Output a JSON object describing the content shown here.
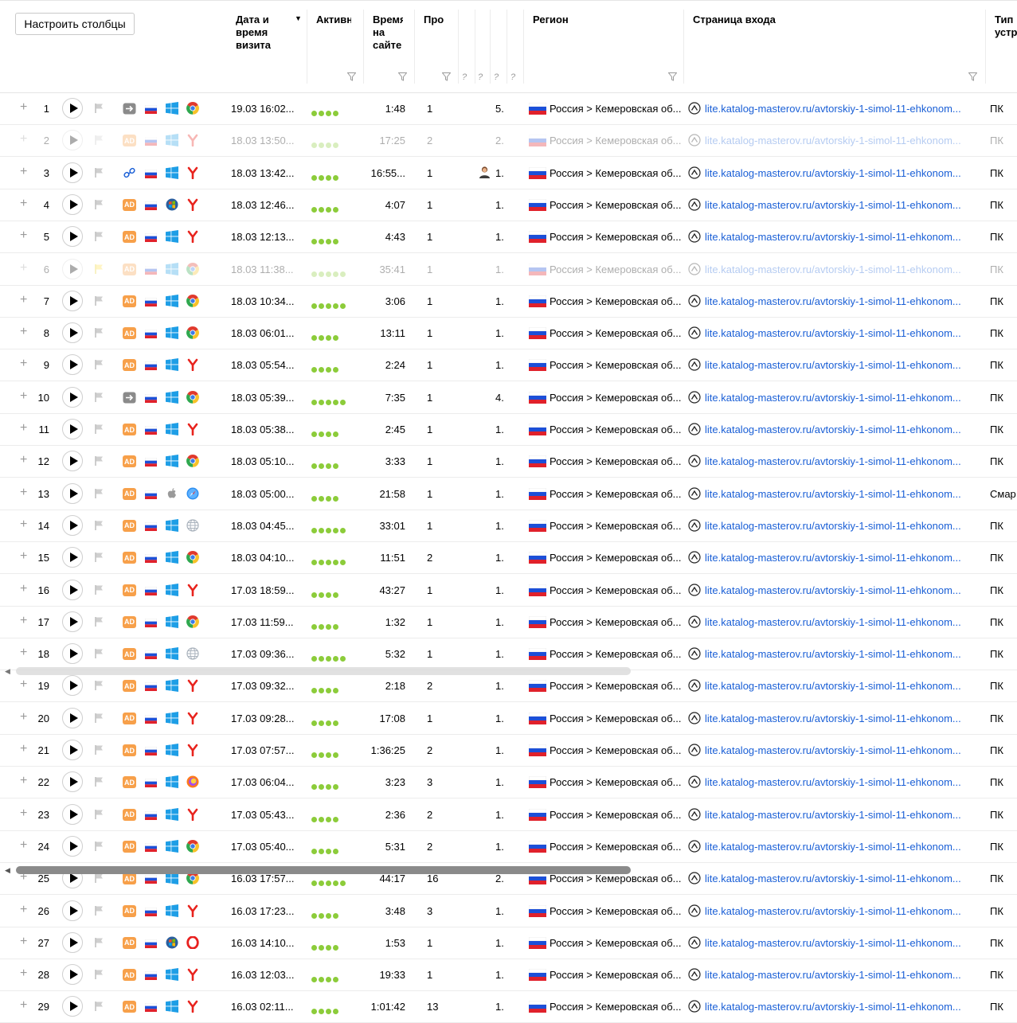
{
  "toolbar": {
    "configure_columns": "Настроить столбцы"
  },
  "columns": {
    "date": "Дата и\nвремя\nвизита",
    "activity": "Активн",
    "time": "Время\nна\nсайте",
    "pages": "Про",
    "region": "Регион",
    "entry_page": "Страница входа",
    "device": "Тип\nустр"
  },
  "sort_indicator": "▼",
  "filter_qmarks": [
    "?",
    "?",
    "?",
    "?"
  ],
  "rows": [
    {
      "n": "1",
      "src": "arrow",
      "os": "windows",
      "br": "chrome",
      "dt": "19.03 16:02...",
      "act": 4,
      "tm": "1:48",
      "pv": "1",
      "dep": "5.",
      "reg": "Россия > Кемеровская об...",
      "url": "lite.katalog-masterov.ru/avtorskiy-1-simol-11-ehkonom...",
      "dev": "ПК"
    },
    {
      "n": "2",
      "dim": true,
      "src": "ad",
      "os": "windows",
      "br": "yandex",
      "dt": "18.03 13:50...",
      "act": 4,
      "tm": "17:25",
      "pv": "2",
      "dep": "2.",
      "reg": "Россия > Кемеровская об...",
      "url": "lite.katalog-masterov.ru/avtorskiy-1-simol-11-ehkonom...",
      "dev": "ПК"
    },
    {
      "n": "3",
      "src": "link",
      "os": "windows",
      "br": "yandex",
      "dt": "18.03 13:42...",
      "act": 4,
      "tm": "16:55...",
      "pv": "1",
      "dep": "1.",
      "avatar": true,
      "reg": "Россия > Кемеровская об...",
      "url": "lite.katalog-masterov.ru/avtorskiy-1-simol-11-ehkonom...",
      "dev": "ПК"
    },
    {
      "n": "4",
      "src": "ad",
      "os": "win7",
      "br": "yandex",
      "dt": "18.03 12:46...",
      "act": 4,
      "tm": "4:07",
      "pv": "1",
      "dep": "1.",
      "reg": "Россия > Кемеровская об...",
      "url": "lite.katalog-masterov.ru/avtorskiy-1-simol-11-ehkonom...",
      "dev": "ПК"
    },
    {
      "n": "5",
      "src": "ad",
      "os": "windows",
      "br": "yandex",
      "dt": "18.03 12:13...",
      "act": 4,
      "tm": "4:43",
      "pv": "1",
      "dep": "1.",
      "reg": "Россия > Кемеровская об...",
      "url": "lite.katalog-masterov.ru/avtorskiy-1-simol-11-ehkonom...",
      "dev": "ПК"
    },
    {
      "n": "6",
      "dim": true,
      "flag_yellow": true,
      "src": "ad",
      "os": "windows",
      "br": "chrome",
      "dt": "18.03 11:38...",
      "act": 5,
      "tm": "35:41",
      "pv": "1",
      "dep": "1.",
      "reg": "Россия > Кемеровская об...",
      "url": "lite.katalog-masterov.ru/avtorskiy-1-simol-11-ehkonom...",
      "dev": "ПК"
    },
    {
      "n": "7",
      "src": "ad",
      "os": "windows",
      "br": "chrome",
      "dt": "18.03 10:34...",
      "act": 5,
      "tm": "3:06",
      "pv": "1",
      "dep": "1.",
      "reg": "Россия > Кемеровская об...",
      "url": "lite.katalog-masterov.ru/avtorskiy-1-simol-11-ehkonom...",
      "dev": "ПК"
    },
    {
      "n": "8",
      "src": "ad",
      "os": "windows",
      "br": "chrome",
      "dt": "18.03 06:01...",
      "act": 4,
      "tm": "13:11",
      "pv": "1",
      "dep": "1.",
      "reg": "Россия > Кемеровская об...",
      "url": "lite.katalog-masterov.ru/avtorskiy-1-simol-11-ehkonom...",
      "dev": "ПК"
    },
    {
      "n": "9",
      "src": "ad",
      "os": "windows",
      "br": "yandex",
      "dt": "18.03 05:54...",
      "act": 4,
      "tm": "2:24",
      "pv": "1",
      "dep": "1.",
      "reg": "Россия > Кемеровская об...",
      "url": "lite.katalog-masterov.ru/avtorskiy-1-simol-11-ehkonom...",
      "dev": "ПК"
    },
    {
      "n": "10",
      "src": "arrow",
      "os": "windows",
      "br": "chrome",
      "dt": "18.03 05:39...",
      "act": 5,
      "tm": "7:35",
      "pv": "1",
      "dep": "4.",
      "reg": "Россия > Кемеровская об...",
      "url": "lite.katalog-masterov.ru/avtorskiy-1-simol-11-ehkonom...",
      "dev": "ПК"
    },
    {
      "n": "11",
      "src": "ad",
      "os": "windows",
      "br": "yandex",
      "dt": "18.03 05:38...",
      "act": 4,
      "tm": "2:45",
      "pv": "1",
      "dep": "1.",
      "reg": "Россия > Кемеровская об...",
      "url": "lite.katalog-masterov.ru/avtorskiy-1-simol-11-ehkonom...",
      "dev": "ПК"
    },
    {
      "n": "12",
      "src": "ad",
      "os": "windows",
      "br": "chrome",
      "dt": "18.03 05:10...",
      "act": 4,
      "tm": "3:33",
      "pv": "1",
      "dep": "1.",
      "reg": "Россия > Кемеровская об...",
      "url": "lite.katalog-masterov.ru/avtorskiy-1-simol-11-ehkonom...",
      "dev": "ПК"
    },
    {
      "n": "13",
      "src": "ad",
      "os": "apple",
      "br": "safari",
      "dt": "18.03 05:00...",
      "act": 4,
      "tm": "21:58",
      "pv": "1",
      "dep": "1.",
      "reg": "Россия > Кемеровская об...",
      "url": "lite.katalog-masterov.ru/avtorskiy-1-simol-11-ehkonom...",
      "dev": "Смар"
    },
    {
      "n": "14",
      "src": "ad",
      "os": "windows",
      "br": "globe",
      "dt": "18.03 04:45...",
      "act": 5,
      "tm": "33:01",
      "pv": "1",
      "dep": "1.",
      "reg": "Россия > Кемеровская об...",
      "url": "lite.katalog-masterov.ru/avtorskiy-1-simol-11-ehkonom...",
      "dev": "ПК"
    },
    {
      "n": "15",
      "src": "ad",
      "os": "windows",
      "br": "chrome",
      "dt": "18.03 04:10...",
      "act": 5,
      "tm": "11:51",
      "pv": "2",
      "dep": "1.",
      "reg": "Россия > Кемеровская об...",
      "url": "lite.katalog-masterov.ru/avtorskiy-1-simol-11-ehkonom...",
      "dev": "ПК"
    },
    {
      "n": "16",
      "src": "ad",
      "os": "windows",
      "br": "yandex",
      "dt": "17.03 18:59...",
      "act": 4,
      "tm": "43:27",
      "pv": "1",
      "dep": "1.",
      "reg": "Россия > Кемеровская об...",
      "url": "lite.katalog-masterov.ru/avtorskiy-1-simol-11-ehkonom...",
      "dev": "ПК"
    },
    {
      "n": "17",
      "src": "ad",
      "os": "windows",
      "br": "chrome",
      "dt": "17.03 11:59...",
      "act": 4,
      "tm": "1:32",
      "pv": "1",
      "dep": "1.",
      "reg": "Россия > Кемеровская об...",
      "url": "lite.katalog-masterov.ru/avtorskiy-1-simol-11-ehkonom...",
      "dev": "ПК"
    },
    {
      "n": "18",
      "src": "ad",
      "os": "windows",
      "br": "globe",
      "dt": "17.03 09:36...",
      "act": 5,
      "tm": "5:32",
      "pv": "1",
      "dep": "1.",
      "reg": "Россия > Кемеровская об...",
      "url": "lite.katalog-masterov.ru/avtorskiy-1-simol-11-ehkonom...",
      "dev": "ПК"
    },
    {
      "n": "19",
      "src": "ad",
      "os": "windows",
      "br": "yandex",
      "dt": "17.03 09:32...",
      "act": 4,
      "tm": "2:18",
      "pv": "2",
      "dep": "1.",
      "reg": "Россия > Кемеровская об...",
      "url": "lite.katalog-masterov.ru/avtorskiy-1-simol-11-ehkonom...",
      "dev": "ПК"
    },
    {
      "n": "20",
      "src": "ad",
      "os": "windows",
      "br": "yandex",
      "dt": "17.03 09:28...",
      "act": 4,
      "tm": "17:08",
      "pv": "1",
      "dep": "1.",
      "reg": "Россия > Кемеровская об...",
      "url": "lite.katalog-masterov.ru/avtorskiy-1-simol-11-ehkonom...",
      "dev": "ПК"
    },
    {
      "n": "21",
      "src": "ad",
      "os": "windows",
      "br": "yandex",
      "dt": "17.03 07:57...",
      "act": 4,
      "tm": "1:36:25",
      "pv": "2",
      "dep": "1.",
      "reg": "Россия > Кемеровская об...",
      "url": "lite.katalog-masterov.ru/avtorskiy-1-simol-11-ehkonom...",
      "dev": "ПК"
    },
    {
      "n": "22",
      "src": "ad",
      "os": "windows",
      "br": "firefox",
      "dt": "17.03 06:04...",
      "act": 4,
      "tm": "3:23",
      "pv": "3",
      "dep": "1.",
      "reg": "Россия > Кемеровская об...",
      "url": "lite.katalog-masterov.ru/avtorskiy-1-simol-11-ehkonom...",
      "dev": "ПК"
    },
    {
      "n": "23",
      "src": "ad",
      "os": "windows",
      "br": "yandex",
      "dt": "17.03 05:43...",
      "act": 4,
      "tm": "2:36",
      "pv": "2",
      "dep": "1.",
      "reg": "Россия > Кемеровская об...",
      "url": "lite.katalog-masterov.ru/avtorskiy-1-simol-11-ehkonom...",
      "dev": "ПК"
    },
    {
      "n": "24",
      "src": "ad",
      "os": "windows",
      "br": "chrome",
      "dt": "17.03 05:40...",
      "act": 4,
      "tm": "5:31",
      "pv": "2",
      "dep": "1.",
      "reg": "Россия > Кемеровская об...",
      "url": "lite.katalog-masterov.ru/avtorskiy-1-simol-11-ehkonom...",
      "dev": "ПК"
    },
    {
      "n": "25",
      "src": "ad",
      "os": "windows",
      "br": "chrome",
      "dt": "16.03 17:57...",
      "act": 5,
      "tm": "44:17",
      "pv": "16",
      "dep": "2.",
      "reg": "Россия > Кемеровская об...",
      "url": "lite.katalog-masterov.ru/avtorskiy-1-simol-11-ehkonom...",
      "dev": "ПК"
    },
    {
      "n": "26",
      "src": "ad",
      "os": "windows",
      "br": "yandex",
      "dt": "16.03 17:23...",
      "act": 4,
      "tm": "3:48",
      "pv": "3",
      "dep": "1.",
      "reg": "Россия > Кемеровская об...",
      "url": "lite.katalog-masterov.ru/avtorskiy-1-simol-11-ehkonom...",
      "dev": "ПК"
    },
    {
      "n": "27",
      "src": "ad",
      "os": "win7",
      "br": "opera",
      "dt": "16.03 14:10...",
      "act": 4,
      "tm": "1:53",
      "pv": "1",
      "dep": "1.",
      "reg": "Россия > Кемеровская об...",
      "url": "lite.katalog-masterov.ru/avtorskiy-1-simol-11-ehkonom...",
      "dev": "ПК"
    },
    {
      "n": "28",
      "src": "ad",
      "os": "windows",
      "br": "yandex",
      "dt": "16.03 12:03...",
      "act": 4,
      "tm": "19:33",
      "pv": "1",
      "dep": "1.",
      "reg": "Россия > Кемеровская об...",
      "url": "lite.katalog-masterov.ru/avtorskiy-1-simol-11-ehkonom...",
      "dev": "ПК"
    },
    {
      "n": "29",
      "src": "ad",
      "os": "windows",
      "br": "yandex",
      "dt": "16.03 02:11...",
      "act": 4,
      "tm": "1:01:42",
      "pv": "13",
      "dep": "1.",
      "reg": "Россия > Кемеровская об...",
      "url": "lite.katalog-masterov.ru/avtorskiy-1-simol-11-ehkonom...",
      "dev": "ПК"
    }
  ],
  "colors": {
    "link": "#1a5fd6",
    "activity": "#8ccc3a",
    "ad_badge": "#f7a04a",
    "scrollbar_dark": "#8a8a8a",
    "scrollbar_light": "#dcdcdc"
  }
}
